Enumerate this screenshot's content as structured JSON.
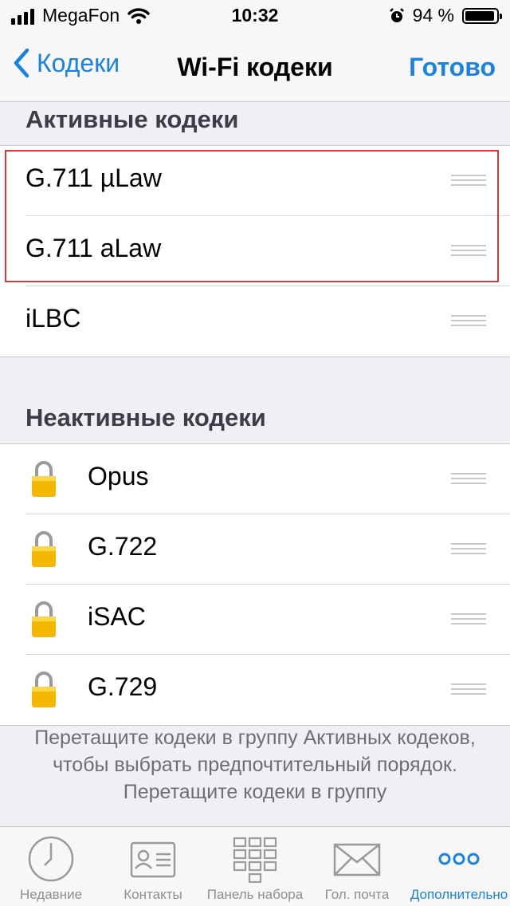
{
  "status_bar": {
    "carrier": "MegaFon",
    "time": "10:32",
    "battery": "94 %",
    "battery_level": 0.94
  },
  "nav": {
    "back_label": "Кодеки",
    "title": "Wi-Fi кодеки",
    "done_label": "Готово"
  },
  "active": {
    "header": "Активные кодеки",
    "items": [
      {
        "label": "G.711 µLaw"
      },
      {
        "label": "G.711 aLaw"
      },
      {
        "label": "iLBC"
      }
    ]
  },
  "inactive": {
    "header": "Неактивные кодеки",
    "items": [
      {
        "label": "Opus"
      },
      {
        "label": "G.722"
      },
      {
        "label": "iSAC"
      },
      {
        "label": "G.729"
      }
    ]
  },
  "footer_text": "Перетащите кодеки в группу Активных кодеков, чтобы выбрать предпочтительный порядок. Перетащите кодеки в группу",
  "tabs": [
    {
      "label": "Недавние",
      "icon": "clock-icon"
    },
    {
      "label": "Контакты",
      "icon": "contact-card-icon"
    },
    {
      "label": "Панель набора",
      "icon": "keypad-icon"
    },
    {
      "label": "Гол. почта",
      "icon": "envelope-icon"
    },
    {
      "label": "Дополнительно",
      "icon": "more-icon"
    }
  ],
  "colors": {
    "accent": "#1a82e2",
    "highlight_border": "#d9383a",
    "lock": "#f5b800"
  }
}
